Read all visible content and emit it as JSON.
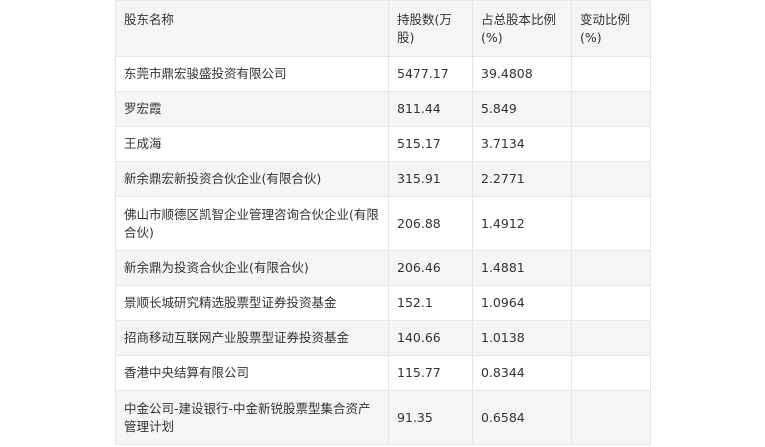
{
  "table": {
    "headers": [
      "股东名称",
      "持股数(万股)",
      "占总股本比例(%)",
      "变动比例(%)"
    ],
    "rows": [
      [
        "东莞市鼎宏骏盛投资有限公司",
        "5477.17",
        "39.4808",
        ""
      ],
      [
        "罗宏霞",
        "811.44",
        "5.849",
        ""
      ],
      [
        "王成海",
        "515.17",
        "3.7134",
        ""
      ],
      [
        "新余鼎宏新投资合伙企业(有限合伙)",
        "315.91",
        "2.2771",
        ""
      ],
      [
        "佛山市顺德区凯智企业管理咨询合伙企业(有限合伙)",
        "206.88",
        "1.4912",
        ""
      ],
      [
        "新余鼎为投资合伙企业(有限合伙)",
        "206.46",
        "1.4881",
        ""
      ],
      [
        "景顺长城研究精选股票型证券投资基金",
        "152.1",
        "1.0964",
        ""
      ],
      [
        "招商移动互联网产业股票型证券投资基金",
        "140.66",
        "1.0138",
        ""
      ],
      [
        "香港中央结算有限公司",
        "115.77",
        "0.8344",
        ""
      ],
      [
        "中金公司-建设银行-中金新锐股票型集合资产管理计划",
        "91.35",
        "0.6584",
        ""
      ]
    ]
  }
}
